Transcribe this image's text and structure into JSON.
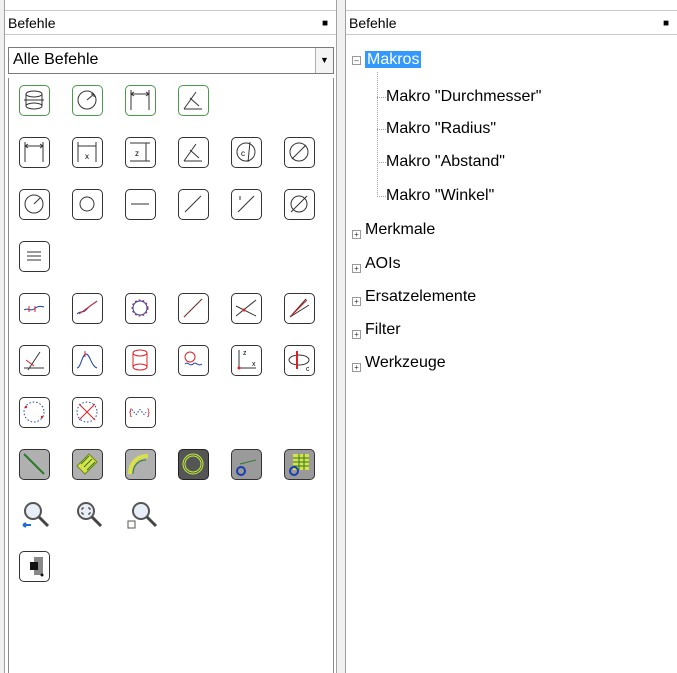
{
  "left_panel": {
    "title": "Befehle",
    "pin_icon": "pin-icon",
    "filter_value": "Alle Befehle",
    "buttons": [
      "cylinder-measure-icon",
      "diameter-icon",
      "distance-icon",
      "angle-icon",
      "distance-icon",
      "distance-x-icon",
      "distance-z-icon",
      "angle-icon",
      "angle-c-icon",
      "diameter-icon",
      "radius-icon",
      "circle-icon",
      "line-icon",
      "line-diagonal-icon",
      "line-offset-icon",
      "cross-line-icon",
      "parallel-lines-icon",
      "profile-curve-icon",
      "profile-fit-icon",
      "circle-fit-icon",
      "line-fit-icon",
      "intersection-icon",
      "angle-lines-icon",
      "angle-point-icon",
      "peak-icon",
      "cylinder-fit-icon",
      "wave-icon",
      "axis-system-icon",
      "ellipse-c-icon",
      "circle-dotted-icon",
      "circle-cross-icon",
      "curve-dotted-icon",
      "aoi-line-icon",
      "aoi-area-icon",
      "aoi-arc-icon",
      "aoi-circle-icon",
      "aoi-refresh-icon",
      "aoi-grid-icon",
      "zoom-back-icon",
      "zoom-fit-icon",
      "zoom-box-icon",
      "contrast-icon"
    ]
  },
  "right_panel": {
    "title": "Befehle",
    "pin_icon": "pin-icon",
    "tree": {
      "makros": {
        "label": "Makros",
        "children": [
          "Makro \"Durchmesser\"",
          "Makro \"Radius\"",
          "Makro \"Abstand\"",
          "Makro \"Winkel\""
        ]
      },
      "merkmale": "Merkmale",
      "aois": "AOIs",
      "ersatzelemente": "Ersatzelemente",
      "filter": "Filter",
      "werkzeuge": "Werkzeuge"
    }
  },
  "colors": {
    "selection": "#3399ff",
    "accent_red": "#e02020",
    "accent_green": "#4a9a4a"
  }
}
